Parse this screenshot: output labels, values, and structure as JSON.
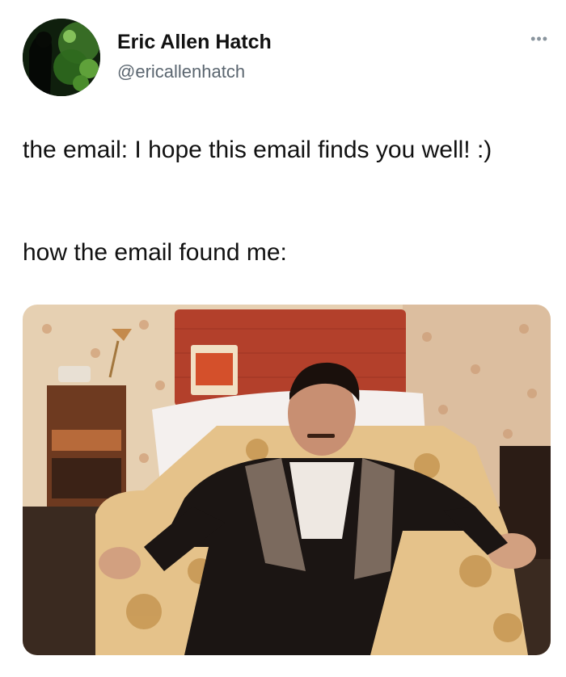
{
  "author": {
    "name": "Eric Allen Hatch",
    "handle": "@ericallenhatch",
    "avatar_icon": "avatar-image"
  },
  "more_menu": {
    "icon": "more-icon",
    "glyph": "•••"
  },
  "tweet": {
    "text_line1": "the email: I hope this email finds you well! :)",
    "text_line2": "how the email found me:"
  },
  "media": {
    "icon": "photo-image",
    "description_colors": {
      "wallpaper": "#e8d3b6",
      "headboard": "#b8432c",
      "armchair": "#e7c58e",
      "clothing": "#1b1513"
    }
  }
}
